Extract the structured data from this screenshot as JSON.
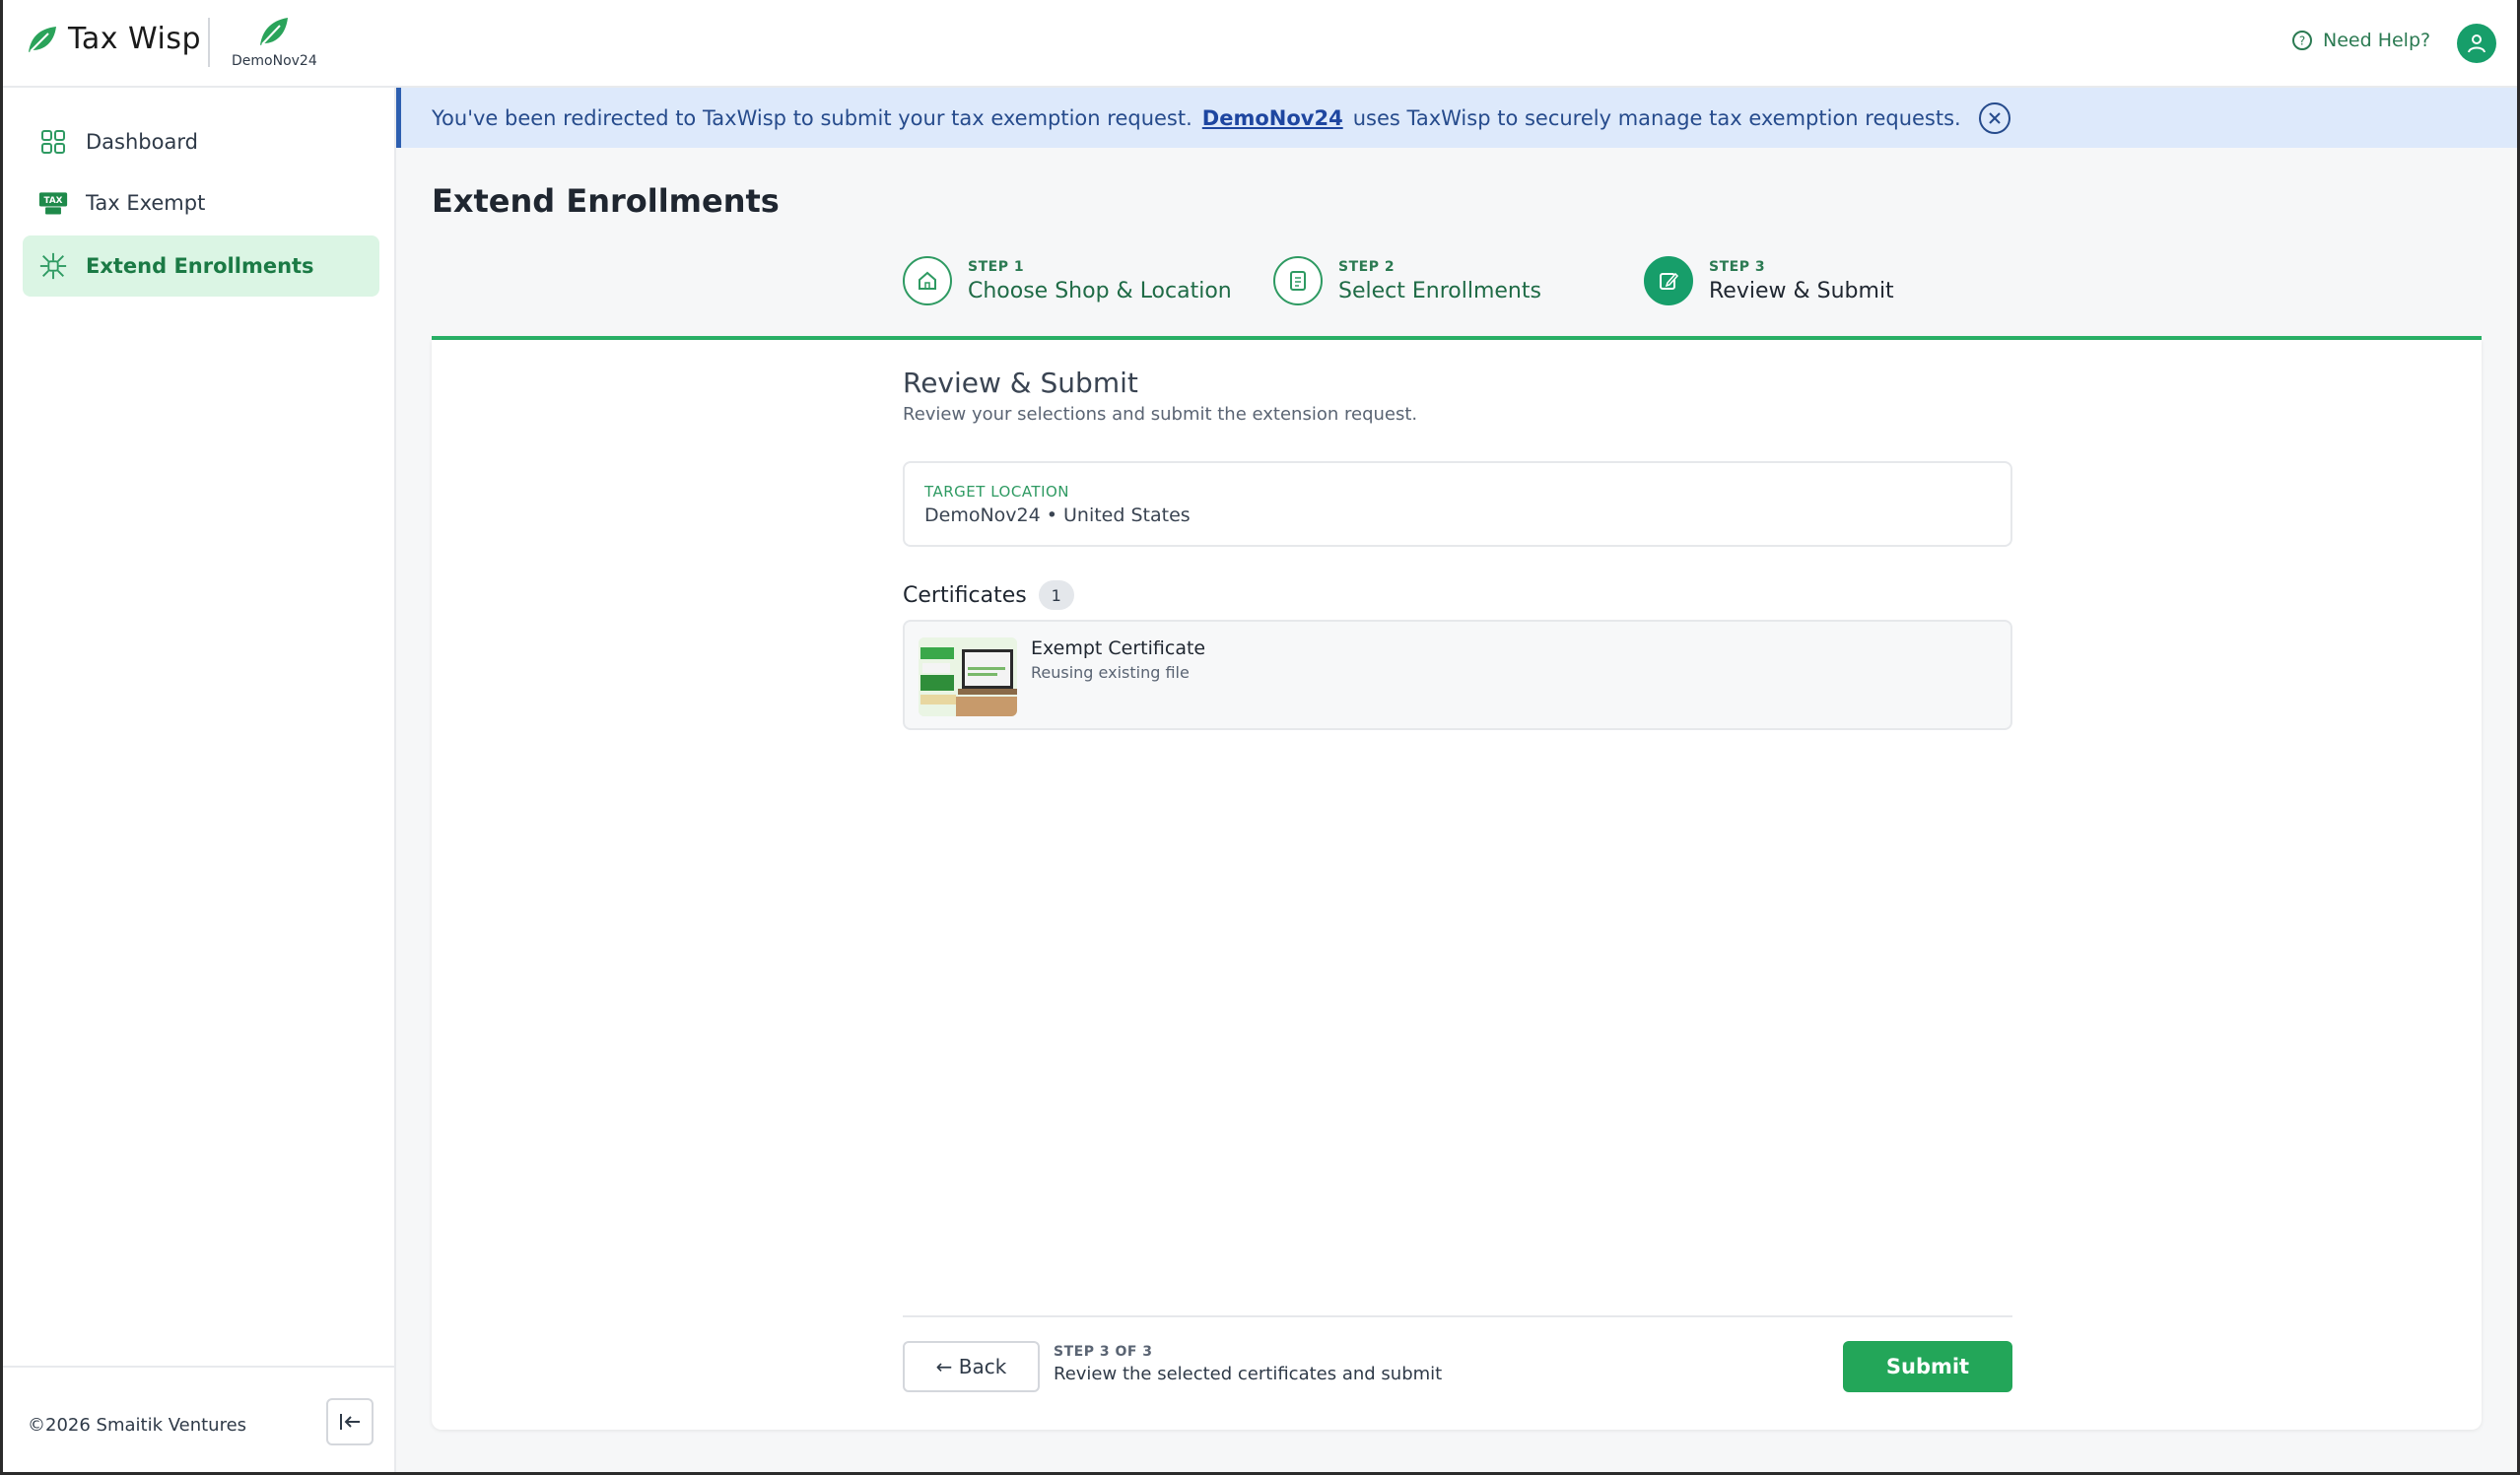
{
  "header": {
    "brand_name": "Tax Wisp",
    "shop_name": "DemoNov24",
    "help_label": "Need Help?"
  },
  "sidebar": {
    "items": [
      {
        "label": "Dashboard",
        "icon": "grid-icon"
      },
      {
        "label": "Tax Exempt",
        "icon": "tax-badge-icon"
      },
      {
        "label": "Extend Enrollments",
        "icon": "network-icon",
        "active": true
      }
    ],
    "copyright": "©2026 Smaitik Ventures"
  },
  "banner": {
    "text_before": "You've been redirected to TaxWisp to submit your tax exemption request.",
    "shop_link": "DemoNov24",
    "text_after": "uses TaxWisp to securely manage tax exemption requests."
  },
  "page": {
    "title": "Extend Enrollments"
  },
  "steps": [
    {
      "num": "STEP 1",
      "label": "Choose Shop & Location"
    },
    {
      "num": "STEP 2",
      "label": "Select Enrollments"
    },
    {
      "num": "STEP 3",
      "label": "Review & Submit"
    }
  ],
  "review": {
    "title": "Review & Submit",
    "subtitle": "Review your selections and submit the extension request.",
    "location_label": "TARGET LOCATION",
    "location_value": "DemoNov24 • United States",
    "certificates_title": "Certificates",
    "certificates_count": "1",
    "certificate": {
      "name": "Exempt Certificate",
      "note": "Reusing existing file"
    }
  },
  "footer": {
    "back_label": "← Back",
    "step_meta": "STEP 3  OF 3",
    "step_desc": "Review the selected certificates and submit",
    "submit_label": "Submit"
  },
  "colors": {
    "accent": "#23a659",
    "active_nav_bg": "#dbf5e4",
    "banner_bg": "#dde9fb"
  }
}
